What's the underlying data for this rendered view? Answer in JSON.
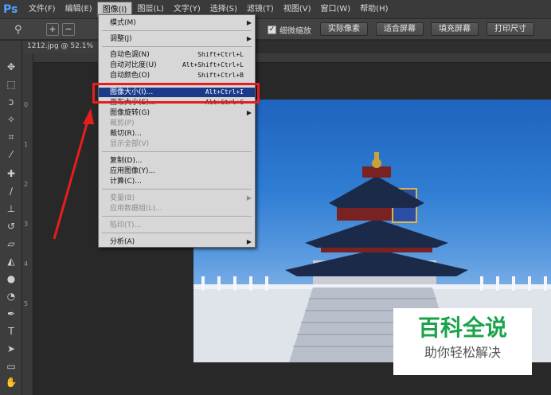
{
  "app": {
    "logo": "Ps"
  },
  "menubar": [
    {
      "label": "文件(F)"
    },
    {
      "label": "编辑(E)"
    },
    {
      "label": "图像(I)"
    },
    {
      "label": "图层(L)"
    },
    {
      "label": "文字(Y)"
    },
    {
      "label": "选择(S)"
    },
    {
      "label": "滤镜(T)"
    },
    {
      "label": "视图(V)"
    },
    {
      "label": "窗口(W)"
    },
    {
      "label": "帮助(H)"
    }
  ],
  "options": {
    "fine_zoom_label": "细微缩放",
    "buttons": [
      "实际像素",
      "适合屏幕",
      "填充屏幕",
      "打印尺寸"
    ]
  },
  "document": {
    "tab_label": "1212.jpg @ 52.1%"
  },
  "ruler": {
    "ticks": [
      "0",
      "1",
      "2",
      "3",
      "4",
      "5"
    ]
  },
  "image_menu": {
    "items": [
      {
        "label": "模式(M)",
        "shortcut": "",
        "submenu": true
      },
      {
        "label": "调整(J)",
        "shortcut": "",
        "submenu": true
      },
      {
        "label": "自动色调(N)",
        "shortcut": "Shift+Ctrl+L"
      },
      {
        "label": "自动对比度(U)",
        "shortcut": "Alt+Shift+Ctrl+L"
      },
      {
        "label": "自动颜色(O)",
        "shortcut": "Shift+Ctrl+B"
      },
      {
        "label": "图像大小(I)...",
        "shortcut": "Alt+Ctrl+I"
      },
      {
        "label": "画布大小(S)...",
        "shortcut": "Alt+Ctrl+C"
      },
      {
        "label": "图像旋转(G)",
        "shortcut": "",
        "submenu": true
      },
      {
        "label": "裁剪(P)",
        "shortcut": ""
      },
      {
        "label": "裁切(R)...",
        "shortcut": ""
      },
      {
        "label": "显示全部(V)",
        "shortcut": ""
      },
      {
        "label": "复制(D)...",
        "shortcut": ""
      },
      {
        "label": "应用图像(Y)...",
        "shortcut": ""
      },
      {
        "label": "计算(C)...",
        "shortcut": ""
      },
      {
        "label": "变量(B)",
        "shortcut": "",
        "submenu": true
      },
      {
        "label": "应用数据组(L)...",
        "shortcut": ""
      },
      {
        "label": "陷印(T)...",
        "shortcut": ""
      },
      {
        "label": "分析(A)",
        "shortcut": "",
        "submenu": true
      }
    ]
  },
  "watermark": {
    "title": "百科全说",
    "subtitle": "助你轻松解决"
  },
  "colors": {
    "highlight": "#1b3a8a",
    "annotation_red": "#e61e1e",
    "watermark_green": "#1aa34a"
  }
}
